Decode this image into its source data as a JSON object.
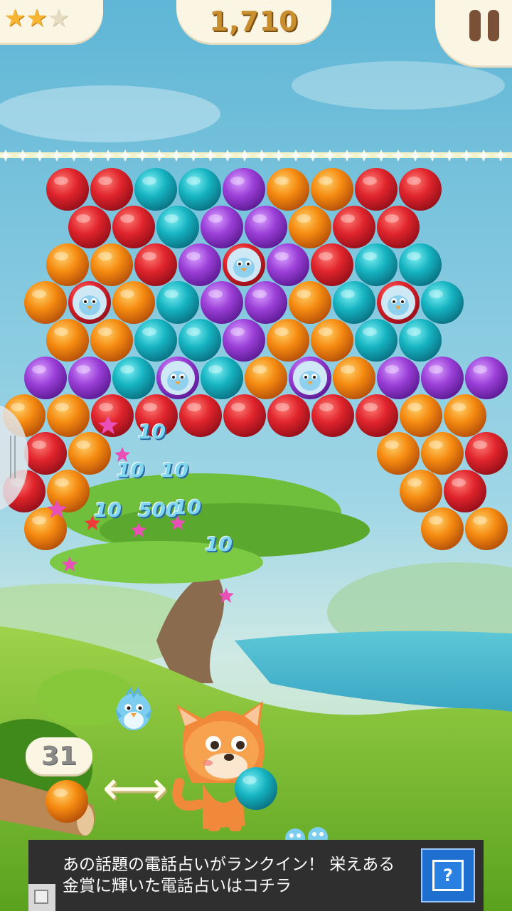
{
  "hud": {
    "stars_earned": 2,
    "stars_total": 3,
    "score": "1,710",
    "moves_left": "31"
  },
  "icons": {
    "pause": "pause-icon",
    "swap": "swap-arrows-icon",
    "star": "star-icon",
    "ad_info": "question-mark-icon"
  },
  "colors": {
    "red": "#d8222b",
    "orange": "#f38a0e",
    "teal": "#17b3c1",
    "purple": "#9a3fd6",
    "star_on": "#f7b531",
    "points_text": "#7fd7f0"
  },
  "board": {
    "rows": [
      {
        "offset": false,
        "balls": [
          "red",
          "red",
          "teal",
          "teal",
          "purple",
          "orange",
          "orange",
          "red",
          "red"
        ]
      },
      {
        "offset": true,
        "balls": [
          "red",
          "red",
          "teal",
          "purple",
          "purple",
          "orange",
          "red",
          "red"
        ]
      },
      {
        "offset": false,
        "balls": [
          "orange",
          "orange",
          "red",
          "purple",
          "red-bird",
          "purple",
          "red",
          "teal",
          "teal"
        ]
      },
      {
        "offset": true,
        "balls": [
          "orange",
          "red-bird",
          "orange",
          "teal",
          "purple",
          "purple",
          "orange",
          "teal",
          "red-bird",
          "teal"
        ]
      },
      {
        "offset": false,
        "balls": [
          "orange",
          "orange",
          "teal",
          "teal",
          "purple",
          "orange",
          "orange",
          "teal",
          "teal"
        ]
      },
      {
        "offset": true,
        "balls": [
          "purple",
          "purple",
          "teal",
          "purple-bird",
          "teal",
          "orange",
          "purple-bird",
          "orange",
          "purple",
          "purple",
          "purple"
        ]
      },
      {
        "offset": false,
        "balls": [
          "orange",
          "orange",
          "red",
          "red",
          "red",
          "red",
          "red",
          "red",
          "red",
          "orange",
          "orange"
        ]
      },
      {
        "offset": true,
        "balls": [
          "red",
          "orange",
          "",
          "",
          "",
          "",
          "",
          "",
          "orange",
          "orange",
          "red"
        ]
      },
      {
        "offset": false,
        "balls": [
          "red",
          "orange",
          "",
          "",
          "",
          "",
          "",
          "",
          "",
          "orange",
          "red"
        ]
      },
      {
        "offset": true,
        "balls": [
          "orange",
          "",
          "",
          "",
          "",
          "",
          "",
          "",
          "",
          "orange",
          "orange"
        ]
      }
    ]
  },
  "points_popups": [
    "10",
    "10",
    "10",
    "10",
    "500",
    "10",
    "10"
  ],
  "shooter": {
    "current_ball": "teal",
    "next_ball": "orange"
  },
  "ad": {
    "line1": "あの話題の電話占いがランクイン！ 栄えある",
    "line2": "金賞に輝いた電話占いはコチラ",
    "icon_glyph": "?"
  }
}
